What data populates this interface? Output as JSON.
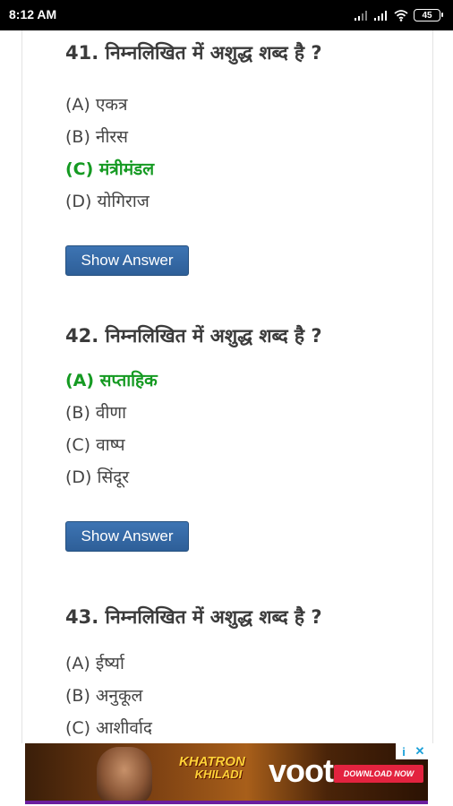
{
  "status_bar": {
    "time": "8:12 AM",
    "battery": "45"
  },
  "questions": [
    {
      "title": "41. निम्नलिखित में अशुद्ध शब्द है ?",
      "options": [
        "(A) एकत्र",
        "(B) नीरस",
        "(C) मंत्रीमंडल",
        "(D) योगिराज"
      ],
      "correct_index": 2,
      "button_label": "Show Answer"
    },
    {
      "title": "42. निम्नलिखित में अशुद्ध शब्द है ?",
      "options": [
        "(A) सप्ताहिक",
        "(B) वीणा",
        "(C) वाष्प",
        "(D) सिंदूर"
      ],
      "correct_index": 0,
      "button_label": "Show Answer"
    },
    {
      "title": "43. निम्नलिखित में अशुद्ध शब्द है ?",
      "options": [
        "(A) ईर्ष्या",
        "(B) अनुकूल",
        "(C) आशीर्वाद"
      ]
    }
  ],
  "ad": {
    "brand_line1": "KHATRON",
    "brand_line2": "KHILADI",
    "brand": "voot",
    "cta": "DOWNLOAD NOW",
    "info_icon": "i",
    "close_icon": "✕"
  },
  "colors": {
    "correct": "#159a22",
    "button": "#336aa8",
    "text": "#3b3b3b"
  }
}
